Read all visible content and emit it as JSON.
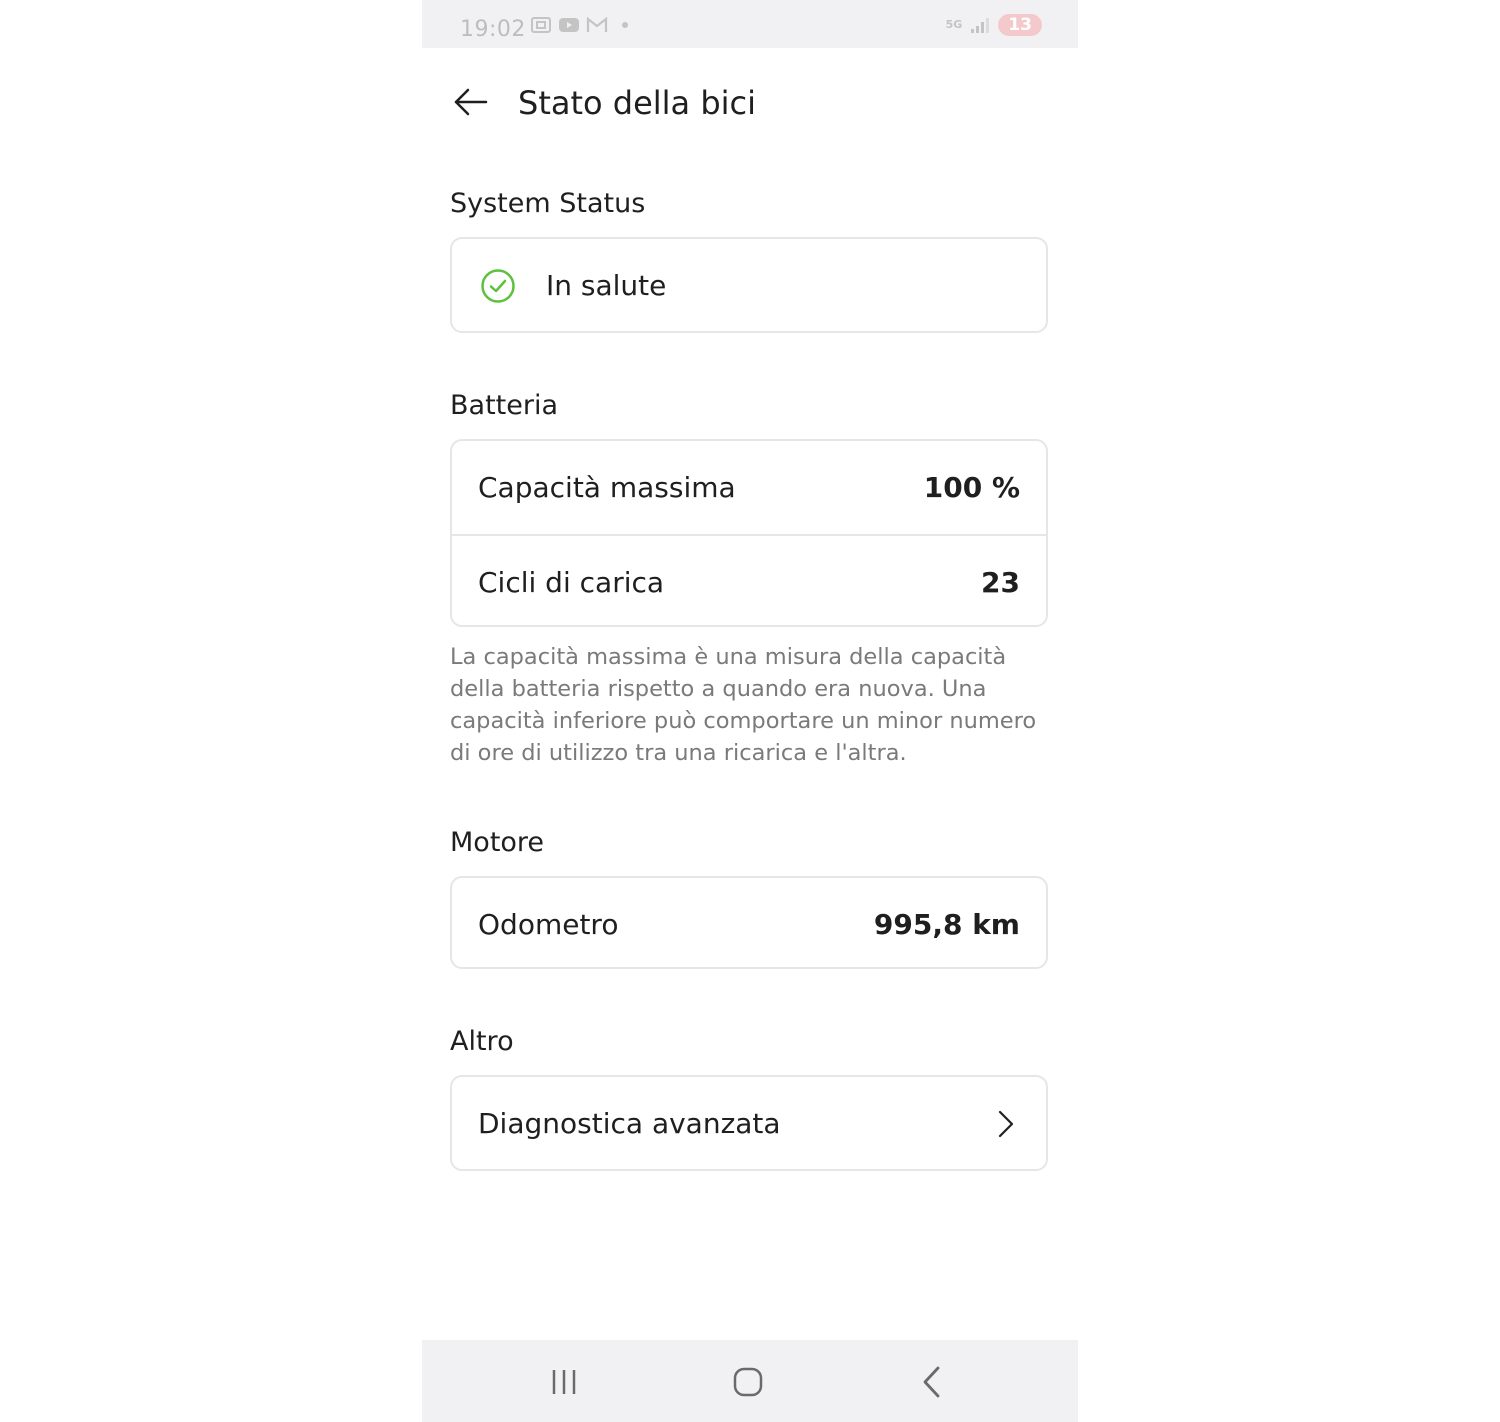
{
  "status_bar": {
    "time": "19:02",
    "network": "5G",
    "battery": "13"
  },
  "header": {
    "title": "Stato della bici"
  },
  "system_status": {
    "section_title": "System Status",
    "state": "In salute",
    "state_color": "#5cc23e"
  },
  "batteria": {
    "section_title": "Batteria",
    "rows": [
      {
        "label": "Capacità massima",
        "value": "100 %"
      },
      {
        "label": "Cicli di carica",
        "value": "23"
      }
    ],
    "note": "La capacità massima è una misura della capacità della batteria rispetto a quando era nuova. Una capacità inferiore può comportare un minor numero di ore di utilizzo tra una ricarica e l'altra."
  },
  "motore": {
    "section_title": "Motore",
    "rows": [
      {
        "label": "Odometro",
        "value": "995,8 km"
      }
    ]
  },
  "altro": {
    "section_title": "Altro",
    "rows": [
      {
        "label": "Diagnostica avanzata"
      }
    ]
  },
  "icons": {
    "back": "arrow-left-icon",
    "status": "check-circle-icon",
    "chevron": "chevron-right-icon",
    "nav_recents": "recents-icon",
    "nav_home": "home-icon",
    "nav_back": "chevron-left-icon"
  }
}
